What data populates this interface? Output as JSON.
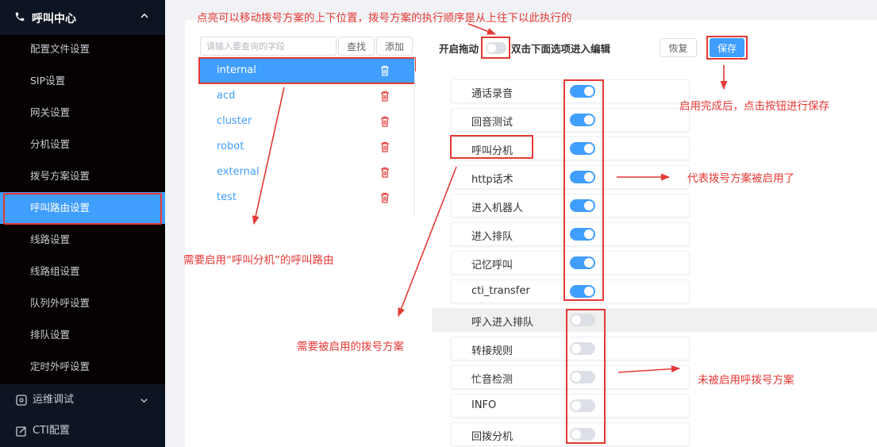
{
  "sidebar": {
    "section": {
      "label": "呼叫中心",
      "icon": "phone-icon"
    },
    "items": [
      {
        "label": "配置文件设置"
      },
      {
        "label": "SIP设置"
      },
      {
        "label": "网关设置"
      },
      {
        "label": "分机设置"
      },
      {
        "label": "拨号方案设置"
      },
      {
        "label": "呼叫路由设置",
        "active": true
      },
      {
        "label": "线路设置"
      },
      {
        "label": "线路组设置"
      },
      {
        "label": "队列外呼设置"
      },
      {
        "label": "排队设置"
      },
      {
        "label": "定时外呼设置"
      }
    ],
    "bottom": [
      {
        "label": "运维调试",
        "icon": "debug-icon"
      },
      {
        "label": "CTI配置",
        "icon": "edit-icon"
      }
    ]
  },
  "search": {
    "placeholder": "请输入要查询的字段",
    "find_label": "查找",
    "add_label": "添加"
  },
  "dialplans": [
    {
      "name": "internal",
      "active": true
    },
    {
      "name": "acd"
    },
    {
      "name": "cluster"
    },
    {
      "name": "robot"
    },
    {
      "name": "external"
    },
    {
      "name": "test"
    }
  ],
  "toolbar": {
    "drag_label": "开启拖动",
    "dblclick_label": "双击下面选项进入编辑",
    "restore_label": "恢复",
    "save_label": "保存",
    "drag_enabled": false
  },
  "options": [
    {
      "label": "通话录音",
      "enabled": true
    },
    {
      "label": "回音测试",
      "enabled": true
    },
    {
      "label": "呼叫分机",
      "enabled": true
    },
    {
      "label": "http话术",
      "enabled": true
    },
    {
      "label": "进入机器人",
      "enabled": true
    },
    {
      "label": "进入排队",
      "enabled": true
    },
    {
      "label": "记忆呼叫",
      "enabled": true
    },
    {
      "label": "cti_transfer",
      "enabled": true
    },
    {
      "label": "呼入进入排队",
      "enabled": false
    },
    {
      "label": "转接规则",
      "enabled": false
    },
    {
      "label": "忙音检测",
      "enabled": false
    },
    {
      "label": "INFO",
      "enabled": false
    },
    {
      "label": "回拨分机",
      "enabled": false
    }
  ],
  "annotations": {
    "top": "点亮可以移动拨号方案的上下位置，拨号方案的执行顺序是从上往下以此执行的",
    "save": "启用完成后，点击按钮进行保存",
    "enabled": "代表拨号方案被启用了",
    "route": "需要启用“呼叫分机”的呼叫路由",
    "need": "需要被启用的拨号方案",
    "disabled": "未被启用呼拨号方案"
  },
  "colors": {
    "accent": "#409eff",
    "annotation": "#e53935",
    "sidebar": "#0e1522"
  }
}
